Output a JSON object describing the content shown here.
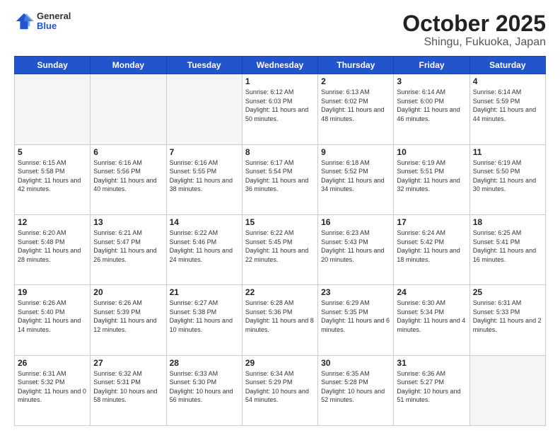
{
  "header": {
    "logo_general": "General",
    "logo_blue": "Blue",
    "title": "October 2025",
    "subtitle": "Shingu, Fukuoka, Japan"
  },
  "days_of_week": [
    "Sunday",
    "Monday",
    "Tuesday",
    "Wednesday",
    "Thursday",
    "Friday",
    "Saturday"
  ],
  "weeks": [
    [
      {
        "day": "",
        "sunrise": "",
        "sunset": "",
        "daylight": "",
        "empty": true
      },
      {
        "day": "",
        "sunrise": "",
        "sunset": "",
        "daylight": "",
        "empty": true
      },
      {
        "day": "",
        "sunrise": "",
        "sunset": "",
        "daylight": "",
        "empty": true
      },
      {
        "day": "1",
        "sunrise": "Sunrise: 6:12 AM",
        "sunset": "Sunset: 6:03 PM",
        "daylight": "Daylight: 11 hours and 50 minutes."
      },
      {
        "day": "2",
        "sunrise": "Sunrise: 6:13 AM",
        "sunset": "Sunset: 6:02 PM",
        "daylight": "Daylight: 11 hours and 48 minutes."
      },
      {
        "day": "3",
        "sunrise": "Sunrise: 6:14 AM",
        "sunset": "Sunset: 6:00 PM",
        "daylight": "Daylight: 11 hours and 46 minutes."
      },
      {
        "day": "4",
        "sunrise": "Sunrise: 6:14 AM",
        "sunset": "Sunset: 5:59 PM",
        "daylight": "Daylight: 11 hours and 44 minutes."
      }
    ],
    [
      {
        "day": "5",
        "sunrise": "Sunrise: 6:15 AM",
        "sunset": "Sunset: 5:58 PM",
        "daylight": "Daylight: 11 hours and 42 minutes."
      },
      {
        "day": "6",
        "sunrise": "Sunrise: 6:16 AM",
        "sunset": "Sunset: 5:56 PM",
        "daylight": "Daylight: 11 hours and 40 minutes."
      },
      {
        "day": "7",
        "sunrise": "Sunrise: 6:16 AM",
        "sunset": "Sunset: 5:55 PM",
        "daylight": "Daylight: 11 hours and 38 minutes."
      },
      {
        "day": "8",
        "sunrise": "Sunrise: 6:17 AM",
        "sunset": "Sunset: 5:54 PM",
        "daylight": "Daylight: 11 hours and 36 minutes."
      },
      {
        "day": "9",
        "sunrise": "Sunrise: 6:18 AM",
        "sunset": "Sunset: 5:52 PM",
        "daylight": "Daylight: 11 hours and 34 minutes."
      },
      {
        "day": "10",
        "sunrise": "Sunrise: 6:19 AM",
        "sunset": "Sunset: 5:51 PM",
        "daylight": "Daylight: 11 hours and 32 minutes."
      },
      {
        "day": "11",
        "sunrise": "Sunrise: 6:19 AM",
        "sunset": "Sunset: 5:50 PM",
        "daylight": "Daylight: 11 hours and 30 minutes."
      }
    ],
    [
      {
        "day": "12",
        "sunrise": "Sunrise: 6:20 AM",
        "sunset": "Sunset: 5:48 PM",
        "daylight": "Daylight: 11 hours and 28 minutes."
      },
      {
        "day": "13",
        "sunrise": "Sunrise: 6:21 AM",
        "sunset": "Sunset: 5:47 PM",
        "daylight": "Daylight: 11 hours and 26 minutes."
      },
      {
        "day": "14",
        "sunrise": "Sunrise: 6:22 AM",
        "sunset": "Sunset: 5:46 PM",
        "daylight": "Daylight: 11 hours and 24 minutes."
      },
      {
        "day": "15",
        "sunrise": "Sunrise: 6:22 AM",
        "sunset": "Sunset: 5:45 PM",
        "daylight": "Daylight: 11 hours and 22 minutes."
      },
      {
        "day": "16",
        "sunrise": "Sunrise: 6:23 AM",
        "sunset": "Sunset: 5:43 PM",
        "daylight": "Daylight: 11 hours and 20 minutes."
      },
      {
        "day": "17",
        "sunrise": "Sunrise: 6:24 AM",
        "sunset": "Sunset: 5:42 PM",
        "daylight": "Daylight: 11 hours and 18 minutes."
      },
      {
        "day": "18",
        "sunrise": "Sunrise: 6:25 AM",
        "sunset": "Sunset: 5:41 PM",
        "daylight": "Daylight: 11 hours and 16 minutes."
      }
    ],
    [
      {
        "day": "19",
        "sunrise": "Sunrise: 6:26 AM",
        "sunset": "Sunset: 5:40 PM",
        "daylight": "Daylight: 11 hours and 14 minutes."
      },
      {
        "day": "20",
        "sunrise": "Sunrise: 6:26 AM",
        "sunset": "Sunset: 5:39 PM",
        "daylight": "Daylight: 11 hours and 12 minutes."
      },
      {
        "day": "21",
        "sunrise": "Sunrise: 6:27 AM",
        "sunset": "Sunset: 5:38 PM",
        "daylight": "Daylight: 11 hours and 10 minutes."
      },
      {
        "day": "22",
        "sunrise": "Sunrise: 6:28 AM",
        "sunset": "Sunset: 5:36 PM",
        "daylight": "Daylight: 11 hours and 8 minutes."
      },
      {
        "day": "23",
        "sunrise": "Sunrise: 6:29 AM",
        "sunset": "Sunset: 5:35 PM",
        "daylight": "Daylight: 11 hours and 6 minutes."
      },
      {
        "day": "24",
        "sunrise": "Sunrise: 6:30 AM",
        "sunset": "Sunset: 5:34 PM",
        "daylight": "Daylight: 11 hours and 4 minutes."
      },
      {
        "day": "25",
        "sunrise": "Sunrise: 6:31 AM",
        "sunset": "Sunset: 5:33 PM",
        "daylight": "Daylight: 11 hours and 2 minutes."
      }
    ],
    [
      {
        "day": "26",
        "sunrise": "Sunrise: 6:31 AM",
        "sunset": "Sunset: 5:32 PM",
        "daylight": "Daylight: 11 hours and 0 minutes."
      },
      {
        "day": "27",
        "sunrise": "Sunrise: 6:32 AM",
        "sunset": "Sunset: 5:31 PM",
        "daylight": "Daylight: 10 hours and 58 minutes."
      },
      {
        "day": "28",
        "sunrise": "Sunrise: 6:33 AM",
        "sunset": "Sunset: 5:30 PM",
        "daylight": "Daylight: 10 hours and 56 minutes."
      },
      {
        "day": "29",
        "sunrise": "Sunrise: 6:34 AM",
        "sunset": "Sunset: 5:29 PM",
        "daylight": "Daylight: 10 hours and 54 minutes."
      },
      {
        "day": "30",
        "sunrise": "Sunrise: 6:35 AM",
        "sunset": "Sunset: 5:28 PM",
        "daylight": "Daylight: 10 hours and 52 minutes."
      },
      {
        "day": "31",
        "sunrise": "Sunrise: 6:36 AM",
        "sunset": "Sunset: 5:27 PM",
        "daylight": "Daylight: 10 hours and 51 minutes."
      },
      {
        "day": "",
        "sunrise": "",
        "sunset": "",
        "daylight": "",
        "empty": true
      }
    ]
  ]
}
